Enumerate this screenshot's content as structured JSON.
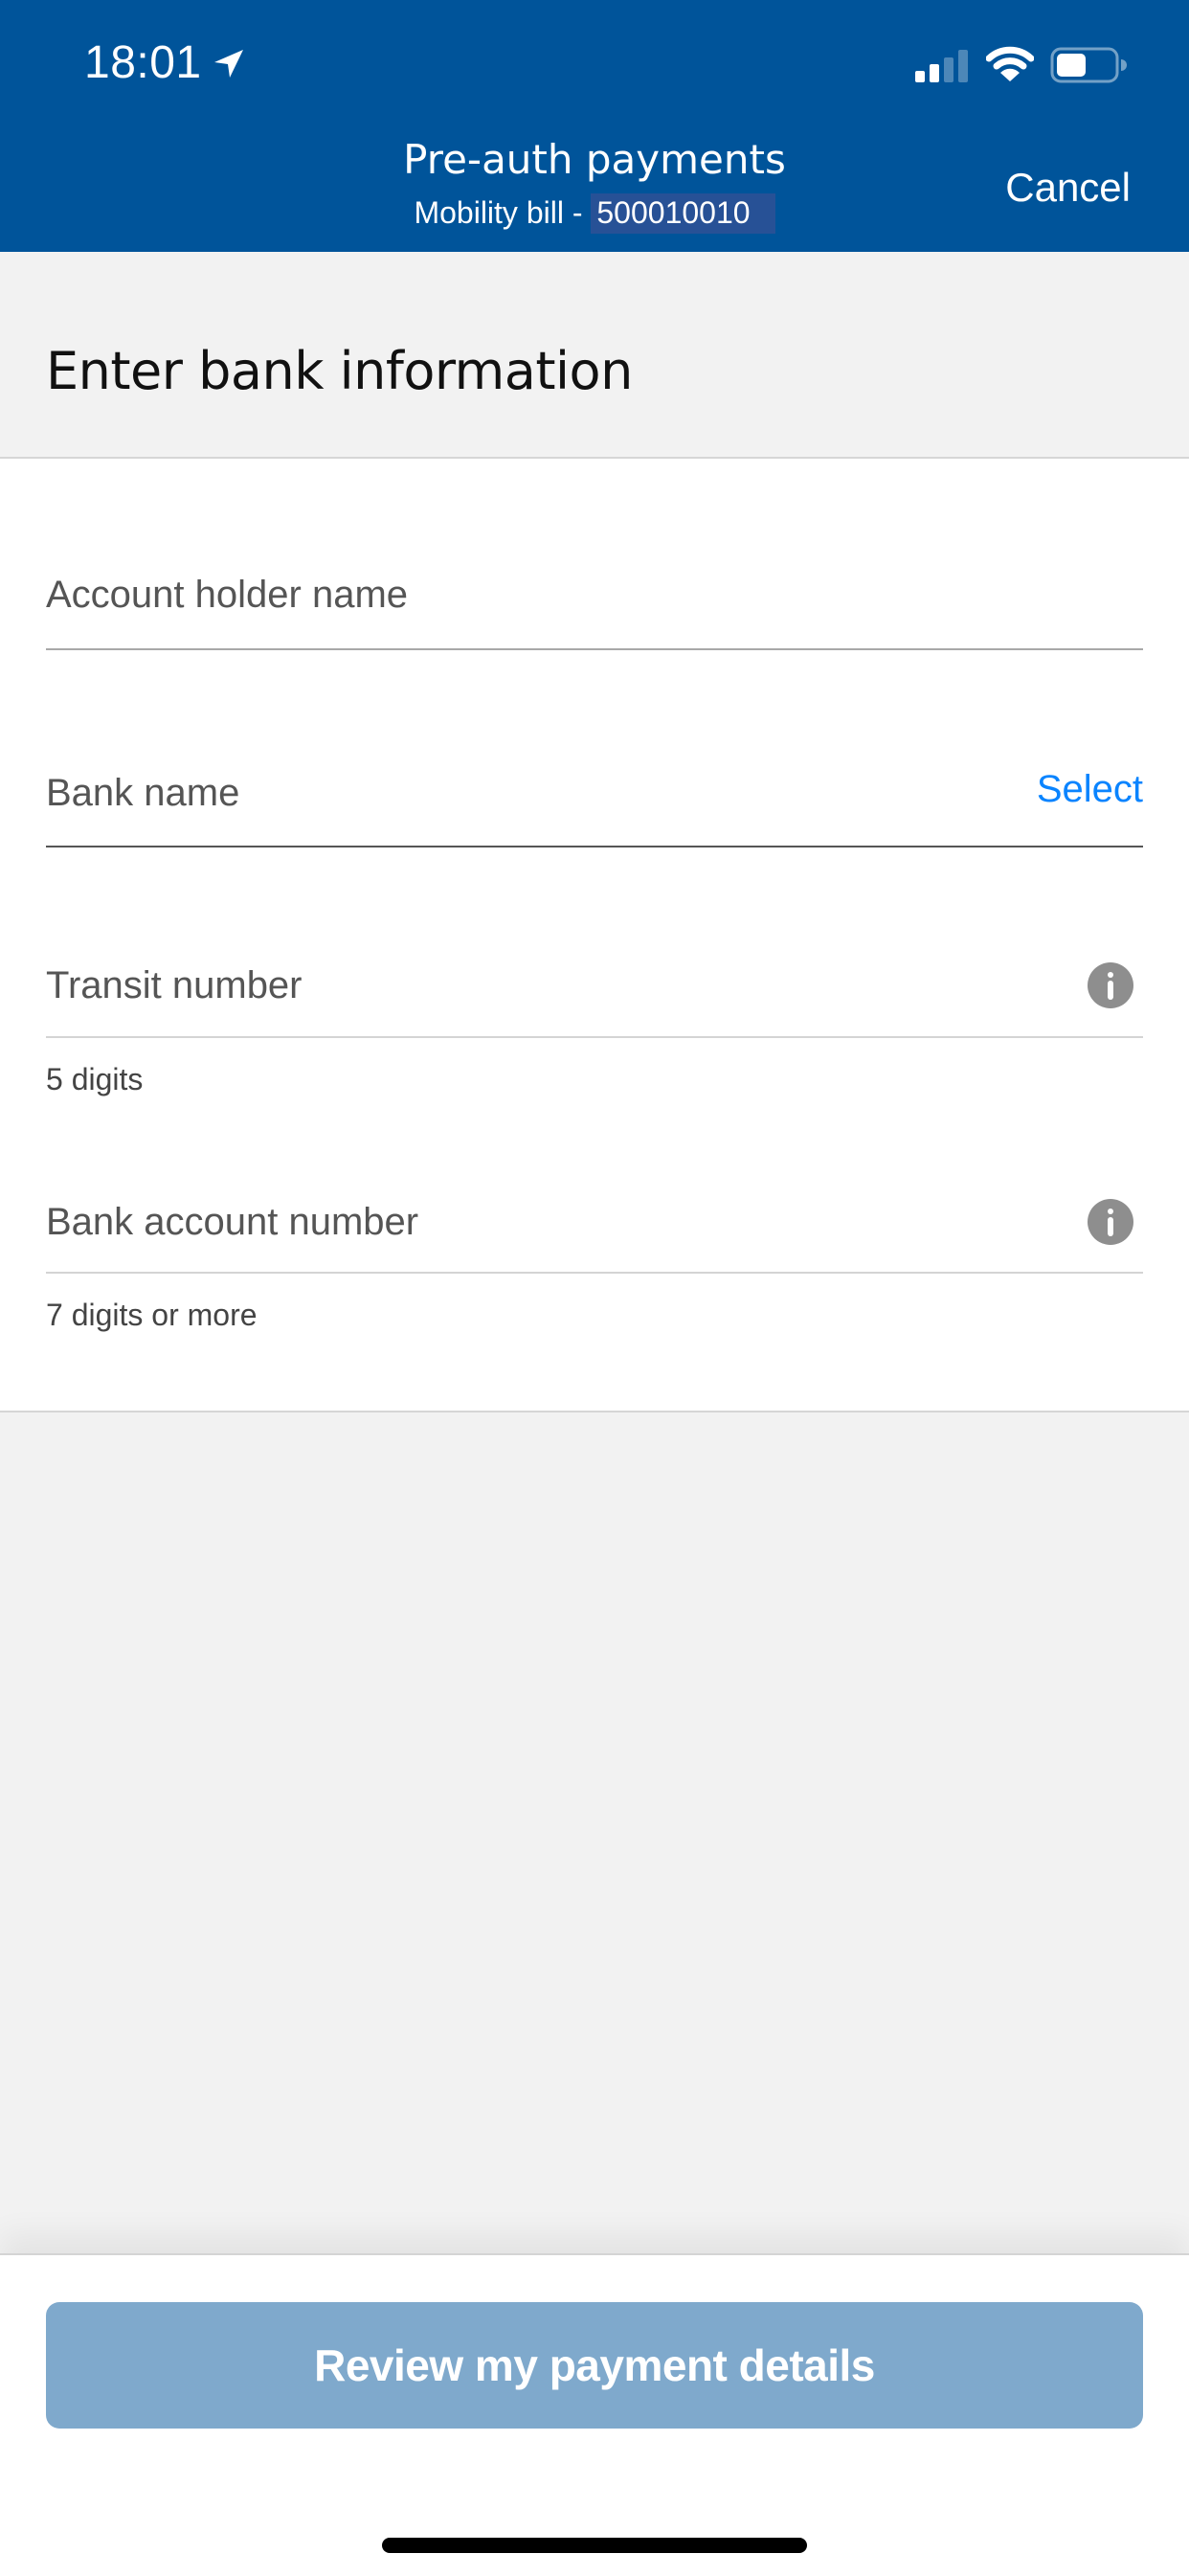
{
  "status_bar": {
    "time": "18:01",
    "location_icon": "location-arrow-icon",
    "signal_icon": "cellular-signal-icon",
    "signal_bars_active": 2,
    "signal_bars_total": 4,
    "wifi_icon": "wifi-icon",
    "battery_icon": "battery-icon",
    "battery_level": 0.5
  },
  "header": {
    "title": "Pre-auth payments",
    "subtitle_prefix": "Mobility bill - ",
    "account_number": "500010010",
    "cancel_label": "Cancel",
    "background_color": "#00549a"
  },
  "section": {
    "title": "Enter bank information"
  },
  "form": {
    "fields": [
      {
        "label": "Account holder name",
        "value": ""
      },
      {
        "label": "Bank name",
        "action_label": "Select",
        "value": ""
      },
      {
        "label": "Transit number",
        "helper": "5 digits",
        "info_icon": "info-icon",
        "value": ""
      },
      {
        "label": "Bank account number",
        "helper": "7 digits or more",
        "info_icon": "info-icon",
        "value": ""
      }
    ],
    "accent_color": "#0a84ff"
  },
  "footer": {
    "review_button_label": "Review my payment details",
    "review_button_color": "#7fa9cc",
    "review_button_enabled": false
  }
}
